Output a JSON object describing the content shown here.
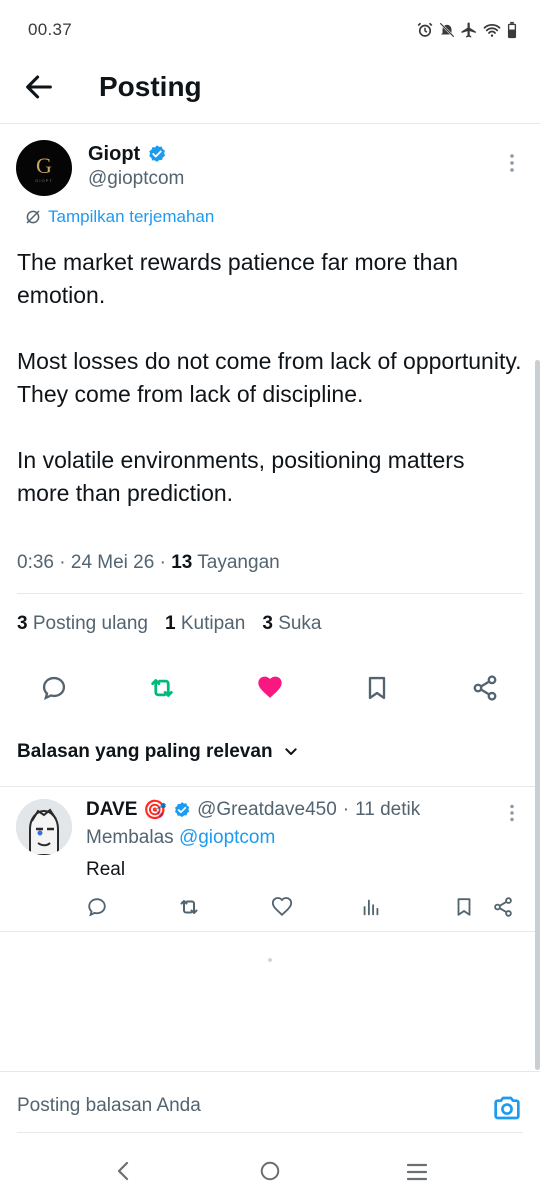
{
  "status_bar": {
    "time": "00.37",
    "icons": [
      "alarm-icon",
      "mute-icon",
      "airplane-icon",
      "wifi-icon",
      "battery-icon"
    ]
  },
  "header": {
    "title": "Posting",
    "back_icon": "back-arrow-icon"
  },
  "post": {
    "author_name": "Giopt",
    "author_handle": "@gioptcom",
    "avatar_letter": "G",
    "avatar_caption": "GIOPT",
    "verified": true,
    "translate_label": "Tampilkan terjemahan",
    "text": "The market rewards patience far more than emotion.\n\nMost losses do not come from lack of opportunity.\nThey come from lack of discipline.\n\nIn volatile environments, positioning matters more than prediction.",
    "time": "0:36",
    "date": "24 Mei 26",
    "views_count": "13",
    "views_label": "Tayangan",
    "separator": "·"
  },
  "stats": {
    "reposts_count": "3",
    "reposts_label": "Posting ulang",
    "quotes_count": "1",
    "quotes_label": "Kutipan",
    "likes_count": "3",
    "likes_label": "Suka"
  },
  "actions": {
    "reply_icon": "comment-icon",
    "repost_icon": "repost-icon",
    "like_icon": "heart-icon",
    "bookmark_icon": "bookmark-icon",
    "share_icon": "share-icon",
    "repost_color": "#00ba7c",
    "like_color": "#f91880"
  },
  "replies_sort": {
    "label": "Balasan yang paling relevan"
  },
  "reply": {
    "author_name": "DAVE",
    "emoji": "🎯",
    "author_handle": "@Greatdave450",
    "separator": "·",
    "time": "11 detik",
    "replying_to_label": "Membalas",
    "replying_to_handle": "@gioptcom",
    "text": "Real"
  },
  "composer": {
    "placeholder": "Posting balasan Anda",
    "camera_icon": "camera-icon"
  },
  "nav": {
    "icons": [
      "nav-back-icon",
      "nav-home-icon",
      "nav-recents-icon"
    ]
  },
  "colors": {
    "accent": "#1d9bf0",
    "text_primary": "#0f1419",
    "text_secondary": "#536471",
    "divider": "#e6e9ec"
  }
}
